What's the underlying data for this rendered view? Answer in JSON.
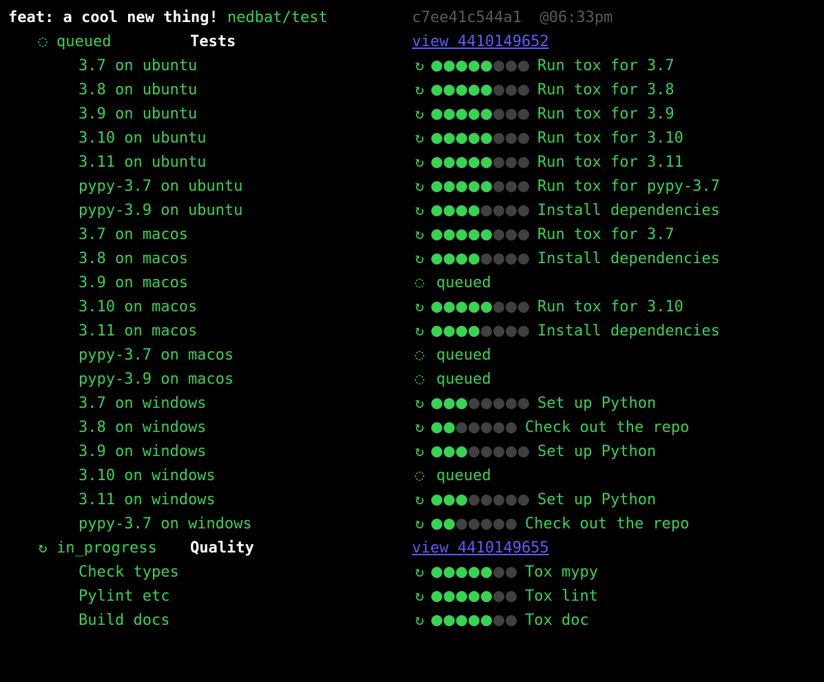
{
  "header": {
    "commit_title": "feat: a cool new thing!",
    "branch": "nedbat/test",
    "sha": "c7ee41c544a1",
    "time": "@06:33pm"
  },
  "groups": [
    {
      "status_icon": "◌",
      "status": "queued",
      "title": "Tests",
      "view_label": "view 4410149652",
      "jobs": [
        {
          "name": "3.7 on ubuntu",
          "kind": "progress",
          "filled": 5,
          "total": 8,
          "step": "Run tox for 3.7"
        },
        {
          "name": "3.8 on ubuntu",
          "kind": "progress",
          "filled": 5,
          "total": 8,
          "step": "Run tox for 3.8"
        },
        {
          "name": "3.9 on ubuntu",
          "kind": "progress",
          "filled": 5,
          "total": 8,
          "step": "Run tox for 3.9"
        },
        {
          "name": "3.10 on ubuntu",
          "kind": "progress",
          "filled": 5,
          "total": 8,
          "step": "Run tox for 3.10"
        },
        {
          "name": "3.11 on ubuntu",
          "kind": "progress",
          "filled": 5,
          "total": 8,
          "step": "Run tox for 3.11"
        },
        {
          "name": "pypy-3.7 on ubuntu",
          "kind": "progress",
          "filled": 5,
          "total": 8,
          "step": "Run tox for pypy-3.7"
        },
        {
          "name": "pypy-3.9 on ubuntu",
          "kind": "progress",
          "filled": 4,
          "total": 8,
          "step": "Install dependencies"
        },
        {
          "name": "3.7 on macos",
          "kind": "progress",
          "filled": 5,
          "total": 8,
          "step": "Run tox for 3.7"
        },
        {
          "name": "3.8 on macos",
          "kind": "progress",
          "filled": 4,
          "total": 8,
          "step": "Install dependencies"
        },
        {
          "name": "3.9 on macos",
          "kind": "queued",
          "label": "queued"
        },
        {
          "name": "3.10 on macos",
          "kind": "progress",
          "filled": 5,
          "total": 8,
          "step": "Run tox for 3.10"
        },
        {
          "name": "3.11 on macos",
          "kind": "progress",
          "filled": 4,
          "total": 8,
          "step": "Install dependencies"
        },
        {
          "name": "pypy-3.7 on macos",
          "kind": "queued",
          "label": "queued"
        },
        {
          "name": "pypy-3.9 on macos",
          "kind": "queued",
          "label": "queued"
        },
        {
          "name": "3.7 on windows",
          "kind": "progress",
          "filled": 3,
          "total": 8,
          "step": "Set up Python"
        },
        {
          "name": "3.8 on windows",
          "kind": "progress",
          "filled": 2,
          "total": 7,
          "step": "Check out the repo"
        },
        {
          "name": "3.9 on windows",
          "kind": "progress",
          "filled": 3,
          "total": 8,
          "step": "Set up Python"
        },
        {
          "name": "3.10 on windows",
          "kind": "queued",
          "label": "queued"
        },
        {
          "name": "3.11 on windows",
          "kind": "progress",
          "filled": 3,
          "total": 8,
          "step": "Set up Python"
        },
        {
          "name": "pypy-3.7 on windows",
          "kind": "progress",
          "filled": 2,
          "total": 7,
          "step": "Check out the repo"
        }
      ]
    },
    {
      "status_icon": "↻",
      "status": "in_progress",
      "title": "Quality",
      "view_label": "view 4410149655",
      "jobs": [
        {
          "name": "Check types",
          "kind": "progress",
          "filled": 5,
          "total": 7,
          "step": "Tox mypy"
        },
        {
          "name": "Pylint etc",
          "kind": "progress",
          "filled": 5,
          "total": 7,
          "step": "Tox lint"
        },
        {
          "name": "Build docs",
          "kind": "progress",
          "filled": 5,
          "total": 7,
          "step": "Tox doc"
        }
      ]
    }
  ],
  "icons": {
    "spinner": "↻",
    "clock": "◌"
  }
}
